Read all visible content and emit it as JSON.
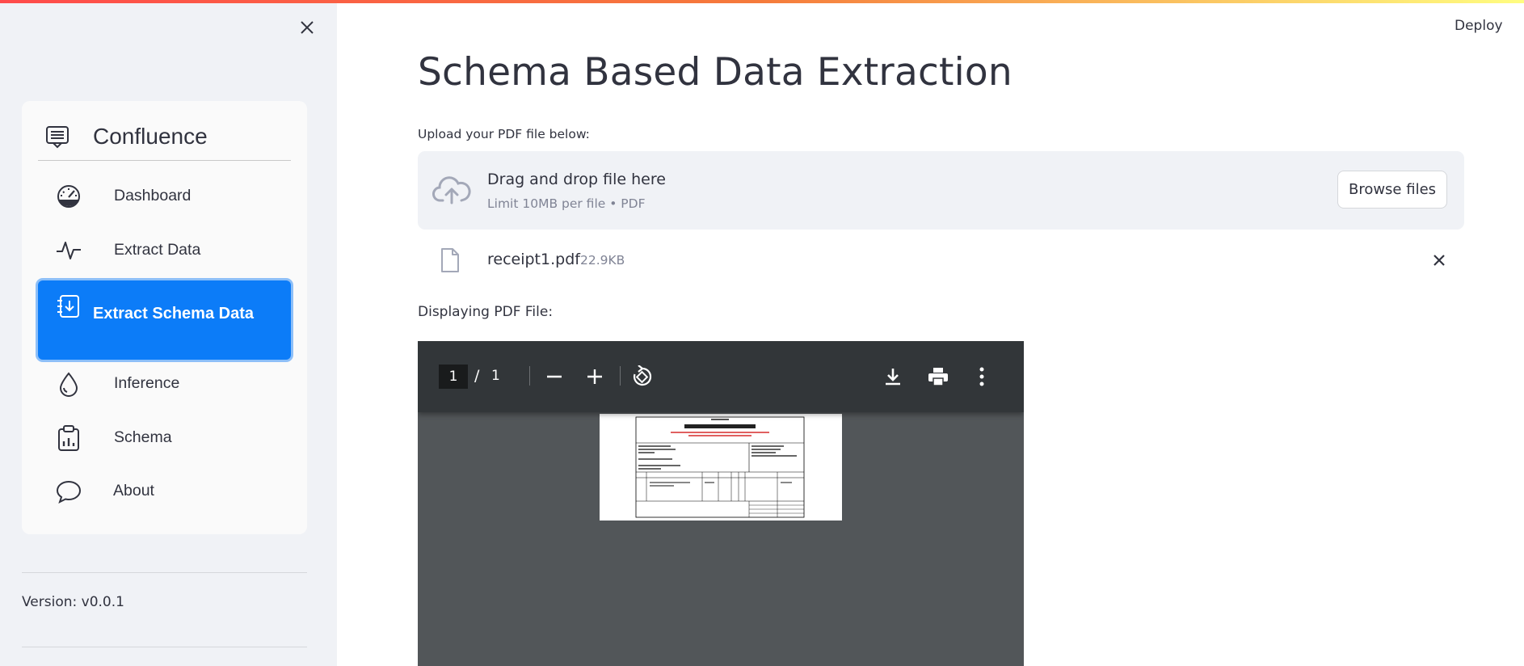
{
  "sidebar": {
    "menu_title": "Confluence",
    "items": [
      {
        "label": "Dashboard",
        "icon": "speedometer-icon",
        "active": false
      },
      {
        "label": "Extract Data",
        "icon": "activity-icon",
        "active": false
      },
      {
        "label": "Extract Schema Data",
        "icon": "journal-arrow-down-icon",
        "active": true
      },
      {
        "label": "Inference",
        "icon": "droplet-icon",
        "active": false
      },
      {
        "label": "Schema",
        "icon": "clipboard-chart-icon",
        "active": false
      },
      {
        "label": "About",
        "icon": "chat-bubble-icon",
        "active": false
      }
    ],
    "version": "Version: v0.0.1"
  },
  "header": {
    "deploy_label": "Deploy"
  },
  "main": {
    "title": "Schema Based Data Extraction",
    "upload_label": "Upload your PDF file below:",
    "dropzone": {
      "main_text": "Drag and drop file here",
      "sub_text": "Limit 10MB per file • PDF",
      "browse_label": "Browse files"
    },
    "uploaded_file": {
      "name": "receipt1.pdf",
      "size": "22.9KB"
    },
    "display_label": "Displaying PDF File:",
    "pdf_viewer": {
      "current_page": "1",
      "separator": "/",
      "total_pages": "1"
    }
  },
  "colors": {
    "accent": "#0c7cf8",
    "sidebar_bg": "#f0f2f6",
    "viewer_bg": "#525659",
    "viewer_toolbar": "#323639"
  }
}
